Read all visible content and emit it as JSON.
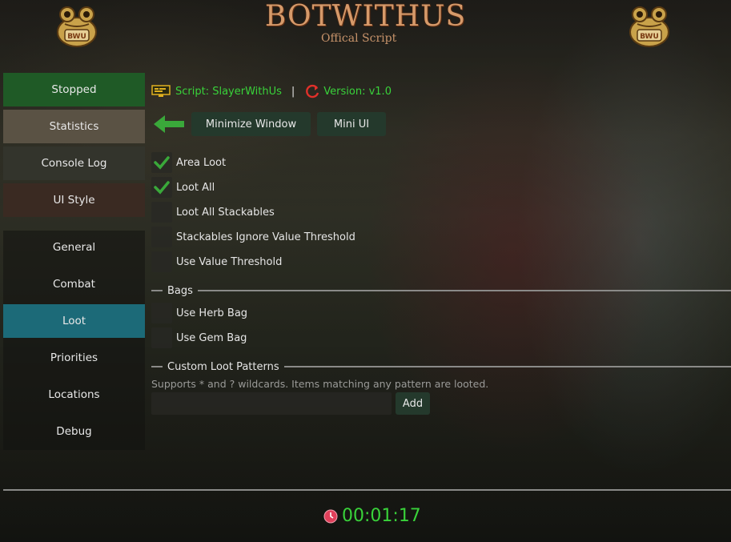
{
  "header": {
    "logo_title": "BOTWITHUS",
    "logo_subtitle": "Offical Script",
    "frog_badge": "BWU"
  },
  "sidebar": {
    "top_buttons": [
      {
        "label": "Stopped",
        "color": "#1f5a26"
      },
      {
        "label": "Statistics",
        "color": "#5a5244"
      },
      {
        "label": "Console Log",
        "color": "#33342c"
      },
      {
        "label": "UI Style",
        "color": "#3a2a22"
      }
    ],
    "nav": [
      {
        "label": "General"
      },
      {
        "label": "Combat"
      },
      {
        "label": "Loot",
        "active": true
      },
      {
        "label": "Priorities"
      },
      {
        "label": "Locations"
      },
      {
        "label": "Debug"
      }
    ]
  },
  "info": {
    "script_label": "Script: SlayerWithUs",
    "divider": "|",
    "version_label": "Version: v1.0"
  },
  "toolbar": {
    "minimize_label": "Minimize Window",
    "mini_ui_label": "Mini UI"
  },
  "loot": {
    "options": [
      {
        "label": "Area Loot",
        "checked": true
      },
      {
        "label": "Loot All",
        "checked": true
      },
      {
        "label": "Loot All Stackables",
        "checked": false
      },
      {
        "label": "Stackables Ignore Value Threshold",
        "checked": false
      },
      {
        "label": "Use Value Threshold",
        "checked": false
      }
    ],
    "bags_heading": "Bags",
    "bags": [
      {
        "label": "Use Herb Bag",
        "checked": false
      },
      {
        "label": "Use Gem Bag",
        "checked": false
      }
    ],
    "patterns_heading": "Custom Loot Patterns",
    "patterns_hint": "Supports * and ? wildcards. Items matching any pattern are looted.",
    "pattern_value": "",
    "add_label": "Add"
  },
  "footer": {
    "timer": "00:01:17"
  },
  "colors": {
    "accent_green": "#39d23a",
    "active_nav": "#1c6a78",
    "button_bg": "#24392c"
  }
}
